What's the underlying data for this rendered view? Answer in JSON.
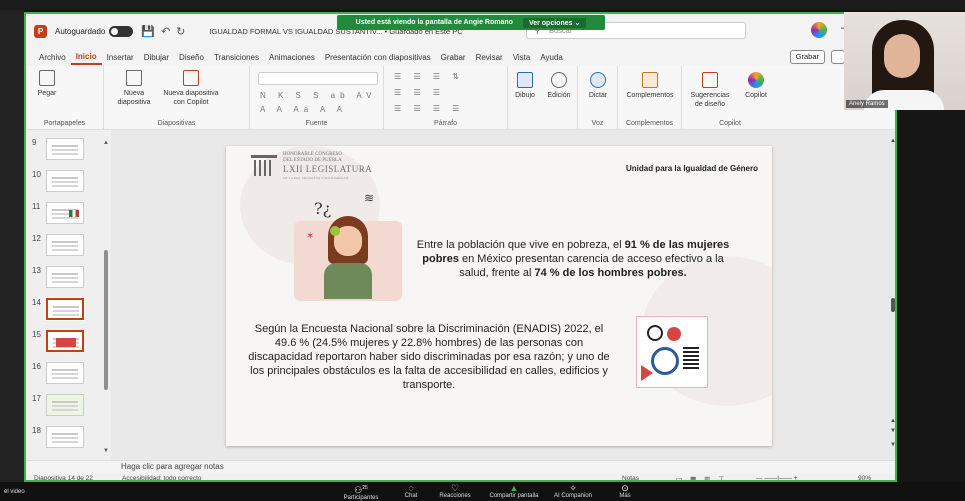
{
  "zoom": {
    "share_banner": "Usted está viendo la pantalla de  Angie Romano",
    "view_options": "Ver opciones",
    "left_label": "el video",
    "controls": [
      {
        "icon": "participants-icon",
        "label": "Participantes",
        "badge": "25"
      },
      {
        "icon": "chat-icon",
        "label": "Chat"
      },
      {
        "icon": "reactions-icon",
        "label": "Reacciones"
      },
      {
        "icon": "share-screen-icon",
        "label": "Compartir pantalla"
      },
      {
        "icon": "ai-companion-icon",
        "label": "AI Companion"
      },
      {
        "icon": "more-icon",
        "label": "Más"
      }
    ],
    "camera_name": "Anely Ramos"
  },
  "pp": {
    "autosave_label": "Autoguardado",
    "doc_title": "IGUALDAD FORMAL VS IGUALDAD SUSTANTIV...  •  Guardado en Este PC",
    "search_placeholder": "Buscar",
    "tabs": [
      "Archivo",
      "Inicio",
      "Insertar",
      "Dibujar",
      "Diseño",
      "Transiciones",
      "Animaciones",
      "Presentación con diapositivas",
      "Grabar",
      "Revisar",
      "Vista",
      "Ayuda"
    ],
    "grabar_button": "Grabar",
    "ribbon": {
      "pegar": "Pegar",
      "portapapeles": "Portapapeles",
      "nueva_diapositiva": "Nueva diapositiva",
      "nueva_copilot": "Nueva diapositiva con Copilot",
      "diapositivas": "Diapositivas",
      "fuente": "Fuente",
      "parrafo": "Párrafo",
      "dibujo": "Dibujo",
      "edicion": "Edición",
      "dictar": "Dictar",
      "voz": "Voz",
      "complementos": "Complementos",
      "complementos_group": "Complementos",
      "sugerencias": "Sugerencias de diseño",
      "copilot": "Copilot",
      "copilot_group": "Copilot",
      "font_glyphs": "N K S S ab AV",
      "font_glyphs2": "A A Aa A A"
    },
    "thumbnails": [
      "9",
      "10",
      "11",
      "12",
      "13",
      "14",
      "15",
      "16",
      "17",
      "18"
    ],
    "notes_placeholder": "Haga clic para agregar notas",
    "status": {
      "slide_info": "Diapositiva 14 de 22",
      "accessibility": "Accesibilidad: todo correcto",
      "notes_btn": "Notas",
      "zoom_pct": "90%"
    }
  },
  "slide": {
    "org_line1": "HONORABLE CONGRESO",
    "org_line2": "DEL ESTADO DE PUEBLA",
    "org_line3": "LXII LEGISLATURA",
    "org_line4": "DE LA PAZ, PROGRESO Y SOLIDARIDAD",
    "unit_label": "Unidad para la Igualdad de Género",
    "stat1_a": "Entre la población que vive en pobreza, el ",
    "stat1_b": "91 % de las mujeres pobres",
    "stat1_c": " en México presentan carencia de acceso efectivo a la salud, frente al ",
    "stat1_d": "74 % de los hombres pobres.",
    "stat2": "Según la Encuesta Nacional sobre la Discriminación (ENADIS) 2022, el 49.6 % (24.5% mujeres y 22.8% hombres) de las personas con discapacidad reportaron haber sido discriminadas por esa razón; y uno de los principales obstáculos es la falta de accesibilidad en calles, edificios y transporte."
  }
}
